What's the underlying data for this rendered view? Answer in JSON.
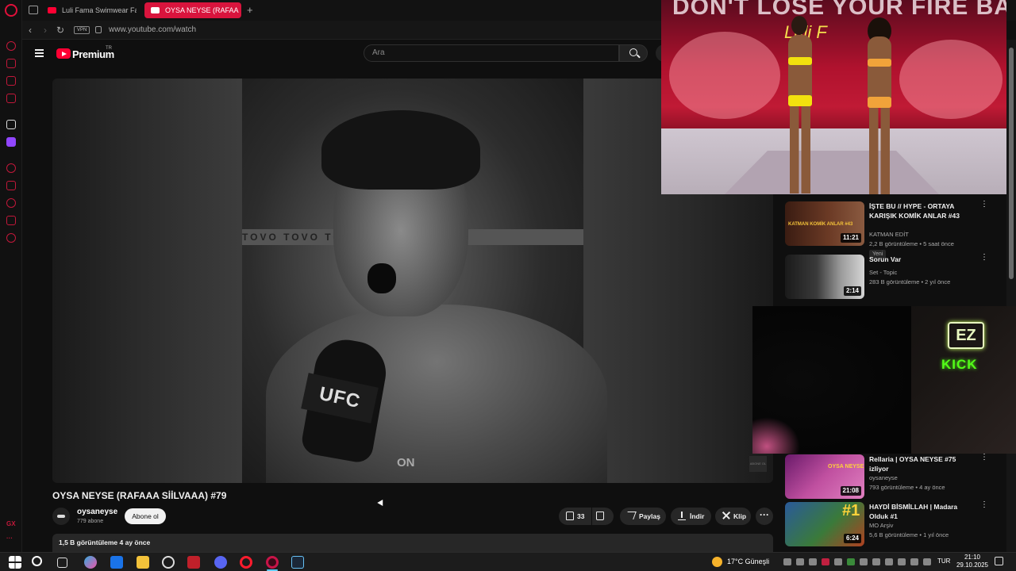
{
  "browser": {
    "tabs": [
      {
        "label": "Luli Fama Swimwear Fash"
      },
      {
        "label": "OYSA NEYSE (RAFAA"
      }
    ],
    "url": "www.youtube.com/watch",
    "vpn_label": "VPN"
  },
  "sidebar": {
    "bottom_label": "GX"
  },
  "youtube": {
    "brand": "Premium",
    "brand_region": "TR",
    "search_placeholder": "Ara"
  },
  "video": {
    "watermark": "ON",
    "corner_text": "ABONE OL",
    "mic_flag": "UFC",
    "banner": "TOVO TOVO TOVO",
    "title": "OYSA NEYSE (RAFAAA SİİLVAAA) #79",
    "channel": "oysaneyse",
    "subscribers": "779 abone",
    "subscribe_label": "Abone ol",
    "likes": "33",
    "share_label": "Paylaş",
    "download_label": "İndir",
    "clip_label": "Klip",
    "views_date": "1,5 B görüntüleme  4 ay önce"
  },
  "pip": {
    "headline": "DON'T LOSE YOUR FIRE BABE",
    "script_text": "Luli F"
  },
  "kick": {
    "ez_label": "EZ",
    "kick_label": "KICK"
  },
  "related": [
    {
      "title": "İŞTE BU // HYPE - ORTAYA KARIŞIK KOMİK ANLAR  #43",
      "channel": "KATMAN EDİT",
      "meta": "2,2 B görüntüleme • 5 saat önce",
      "badge": "Yeni",
      "duration": "11:21",
      "thumb_text": "KATMAN KOMİK ANLAR #43"
    },
    {
      "title": "Sorun Var",
      "channel": "Set - Topic",
      "meta": "283 B görüntüleme • 2 yıl önce",
      "duration": "2:14"
    },
    {
      "title": "Rellaria | OYSA NEYSE #75 izliyor",
      "channel": "oysaneyse",
      "meta": "793 görüntüleme • 4 ay önce",
      "duration": "21:08",
      "thumb_text": "OYSA NEYSE"
    },
    {
      "title": "HAYDİ BİSMİLLAH | Madara Olduk #1",
      "channel": "MO Arşiv",
      "meta": "5,6 B görüntüleme • 1 yıl önce",
      "duration": "6:24",
      "thumb_text": "#1"
    }
  ],
  "taskbar": {
    "weather": "17°C  Güneşli",
    "language": "TUR",
    "time": "21:10",
    "date": "29.10.2025"
  }
}
